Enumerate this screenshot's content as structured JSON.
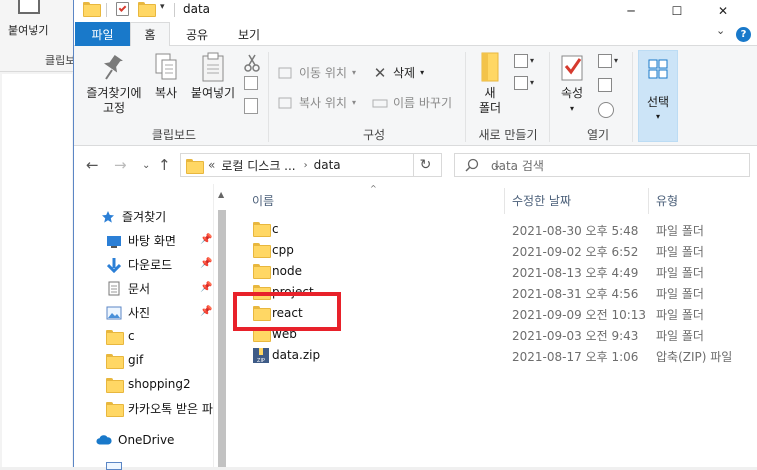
{
  "background_window": {
    "ribbon_label": "붙여넣기",
    "group_label": "클립보"
  },
  "titlebar": {
    "title": "data",
    "minimize": "─",
    "maximize": "☐",
    "close": "✕"
  },
  "tabs": {
    "file": "파일",
    "home": "홈",
    "share": "공유",
    "view": "보기",
    "collapse": "⌄",
    "help": "?"
  },
  "ribbon": {
    "clipboard": {
      "pin_label_line1": "즐겨찾기에",
      "pin_label_line2": "고정",
      "copy": "복사",
      "paste": "붙여넣기",
      "group": "클립보드"
    },
    "organize": {
      "move_to": "이동 위치",
      "copy_to": "복사 위치",
      "delete": "삭제",
      "rename": "이름 바꾸기",
      "group": "구성"
    },
    "new": {
      "new_folder_line1": "새",
      "new_folder_line2": "폴더",
      "group": "새로 만들기"
    },
    "open": {
      "properties": "속성",
      "group": "열기"
    },
    "select": {
      "label": "선택"
    }
  },
  "address": {
    "back": "←",
    "forward": "→",
    "recent": "⌄",
    "up": "↑",
    "prefix": "«",
    "crumb1": "로컬 디스크 ...",
    "sep": "›",
    "crumb2": "data",
    "dropdown": "⌄",
    "refresh": "↻",
    "search_placeholder": "data 검색"
  },
  "navpane": {
    "items": [
      {
        "label": "즐겨찾기",
        "icon": "star-icon",
        "pinned": false
      },
      {
        "label": "바탕 화면",
        "icon": "desktop-icon",
        "pinned": true
      },
      {
        "label": "다운로드",
        "icon": "download-icon",
        "pinned": true
      },
      {
        "label": "문서",
        "icon": "document-icon",
        "pinned": true
      },
      {
        "label": "사진",
        "icon": "picture-icon",
        "pinned": true
      },
      {
        "label": "c",
        "icon": "folder-icon",
        "pinned": false
      },
      {
        "label": "gif",
        "icon": "folder-icon",
        "pinned": false
      },
      {
        "label": "shopping2",
        "icon": "folder-icon",
        "pinned": false
      },
      {
        "label": "카카오톡 받은 파",
        "icon": "folder-icon",
        "pinned": false
      },
      {
        "label": "OneDrive",
        "icon": "cloud-icon",
        "pinned": false
      }
    ],
    "pin_glyph": "📌"
  },
  "list": {
    "columns": {
      "name": "이름",
      "date": "수정한 날짜",
      "type": "유형"
    },
    "sort_indicator": "^",
    "rows": [
      {
        "name": "c",
        "date": "2021-08-30 오후 5:48",
        "type": "파일 폴더",
        "kind": "folder"
      },
      {
        "name": "cpp",
        "date": "2021-09-02 오후 6:52",
        "type": "파일 폴더",
        "kind": "folder"
      },
      {
        "name": "node",
        "date": "2021-08-13 오후 4:49",
        "type": "파일 폴더",
        "kind": "folder"
      },
      {
        "name": "project",
        "date": "2021-08-31 오후 4:56",
        "type": "파일 폴더",
        "kind": "folder"
      },
      {
        "name": "react",
        "date": "2021-09-09 오전 10:13",
        "type": "파일 폴더",
        "kind": "folder"
      },
      {
        "name": "web",
        "date": "2021-09-03 오전 9:43",
        "type": "파일 폴더",
        "kind": "folder"
      },
      {
        "name": "data.zip",
        "date": "2021-08-17 오후 1:06",
        "type": "압축(ZIP) 파일",
        "kind": "zip"
      }
    ]
  },
  "colors": {
    "accent": "#1979ca",
    "highlight": "#e8212a",
    "folder": "#ffd764",
    "folder_edge": "#e8b73e"
  }
}
